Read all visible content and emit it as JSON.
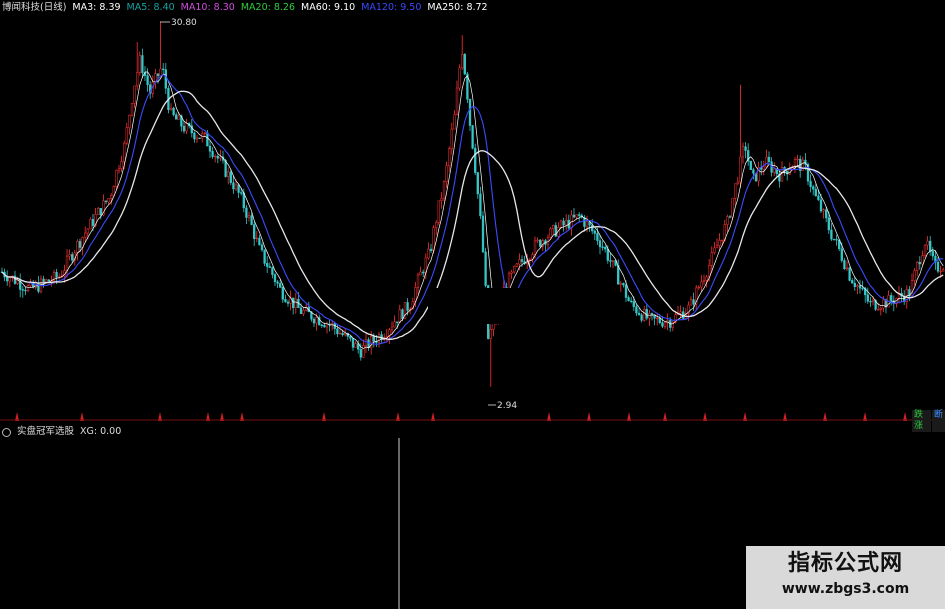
{
  "header": {
    "stock_name": "博闻科技(日线)",
    "ma": [
      {
        "label": "MA3: 8.39",
        "color": "#ffffff"
      },
      {
        "label": "MA5: 8.40",
        "color": "#17a2a2"
      },
      {
        "label": "MA10: 8.30",
        "color": "#d24be0"
      },
      {
        "label": "MA20: 8.26",
        "color": "#2ecc40"
      },
      {
        "label": "MA60: 9.10",
        "color": "#ffffff"
      },
      {
        "label": "MA120: 9.50",
        "color": "#3a4bff"
      },
      {
        "label": "MA250: 8.72",
        "color": "#ffffff"
      }
    ]
  },
  "sub_header": {
    "indicator_name": "实盘冠军选股",
    "value_label": "XG: 0.00"
  },
  "annotations": {
    "high_label": "30.80",
    "low_label": "2.94"
  },
  "buttons": {
    "tab1": "跌涨",
    "tab2": "断"
  },
  "watermark": {
    "title": "指标公式网",
    "url": "www.zbgs3.com"
  },
  "colors": {
    "background": "#000000",
    "up": "#ff3333",
    "down": "#36c7c7",
    "ma_white": "#e8e8e8",
    "ma_blue": "#3a4bff",
    "divider": "#7a0f0f",
    "signal": "#d42020"
  },
  "chart_data": {
    "type": "candlestick",
    "title": "博闻科技(日线)",
    "ylim": [
      2.5,
      31.5
    ],
    "price_path": [
      [
        0,
        6.2
      ],
      [
        30,
        5.5
      ],
      [
        60,
        6.0
      ],
      [
        90,
        8.3
      ],
      [
        110,
        10.0
      ],
      [
        125,
        14.0
      ],
      [
        135,
        21.0
      ],
      [
        140,
        24.0
      ],
      [
        150,
        19.5
      ],
      [
        162,
        23.0
      ],
      [
        170,
        17.0
      ],
      [
        185,
        15.5
      ],
      [
        205,
        14.5
      ],
      [
        220,
        12.5
      ],
      [
        240,
        10.0
      ],
      [
        260,
        7.0
      ],
      [
        280,
        5.5
      ],
      [
        300,
        4.8
      ],
      [
        330,
        4.4
      ],
      [
        360,
        3.7
      ],
      [
        385,
        4.2
      ],
      [
        410,
        5.0
      ],
      [
        430,
        7.0
      ],
      [
        445,
        11.0
      ],
      [
        455,
        17.0
      ],
      [
        462,
        26.0
      ],
      [
        470,
        16.0
      ],
      [
        478,
        10.0
      ],
      [
        488,
        4.0
      ],
      [
        495,
        4.5
      ],
      [
        505,
        5.6
      ],
      [
        520,
        6.5
      ],
      [
        540,
        7.5
      ],
      [
        560,
        8.2
      ],
      [
        580,
        8.8
      ],
      [
        600,
        7.5
      ],
      [
        615,
        6.2
      ],
      [
        630,
        5.0
      ],
      [
        650,
        4.5
      ],
      [
        670,
        4.5
      ],
      [
        690,
        4.9
      ],
      [
        710,
        6.5
      ],
      [
        728,
        8.5
      ],
      [
        738,
        11.5
      ],
      [
        745,
        14.0
      ],
      [
        752,
        11.0
      ],
      [
        765,
        12.5
      ],
      [
        780,
        11.5
      ],
      [
        795,
        12.5
      ],
      [
        805,
        12.0
      ],
      [
        815,
        10.0
      ],
      [
        830,
        8.0
      ],
      [
        850,
        6.0
      ],
      [
        870,
        5.0
      ],
      [
        890,
        5.1
      ],
      [
        910,
        5.4
      ],
      [
        925,
        7.5
      ],
      [
        935,
        6.3
      ],
      [
        945,
        6.5
      ]
    ],
    "spikes": [
      {
        "x": 160,
        "high": 30.8
      },
      {
        "x": 138,
        "high": 27.0
      },
      {
        "x": 462,
        "high": 28.2
      },
      {
        "x": 741,
        "high": 20.5
      },
      {
        "x": 490,
        "low": 2.94
      }
    ],
    "signals_x": [
      17,
      82,
      160,
      208,
      222,
      242,
      324,
      398,
      433,
      549,
      589,
      629,
      665,
      705,
      745,
      785,
      825,
      865,
      905
    ],
    "high": 30.8,
    "low": 2.94
  }
}
